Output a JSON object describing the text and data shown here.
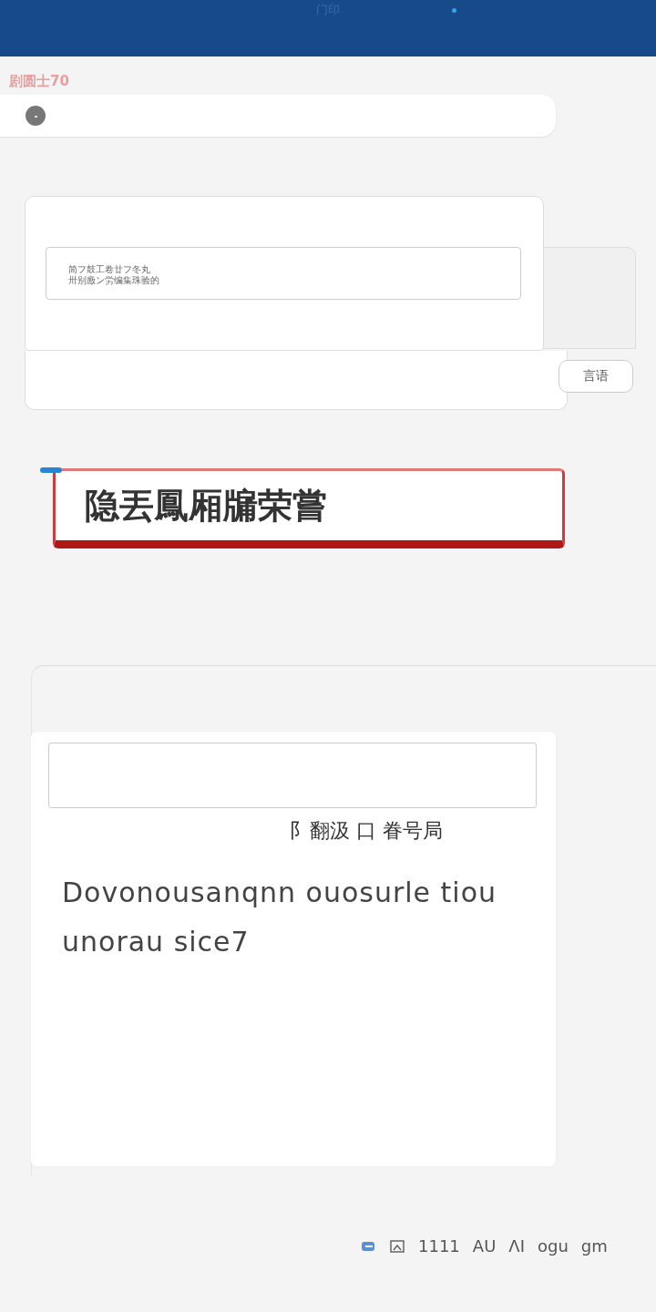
{
  "header": {
    "title": "门印"
  },
  "subtitle": "剧圆士70",
  "note_card": {
    "field_lines": [
      "简フ鼓工卷廿フ冬丸",
      "卅别廒ン労编集珠验的"
    ],
    "action": "言语"
  },
  "banner": {
    "title": "隐丟鳳厢牖荣嘗"
  },
  "question_card": {
    "label": "阝翻汲 口 眷号局",
    "body": "Dovonousanqnn ouosurle tiou unorau sice7"
  },
  "footer": {
    "items": [
      "1111",
      "AU",
      "ΛI",
      "ogu",
      "gm"
    ]
  }
}
